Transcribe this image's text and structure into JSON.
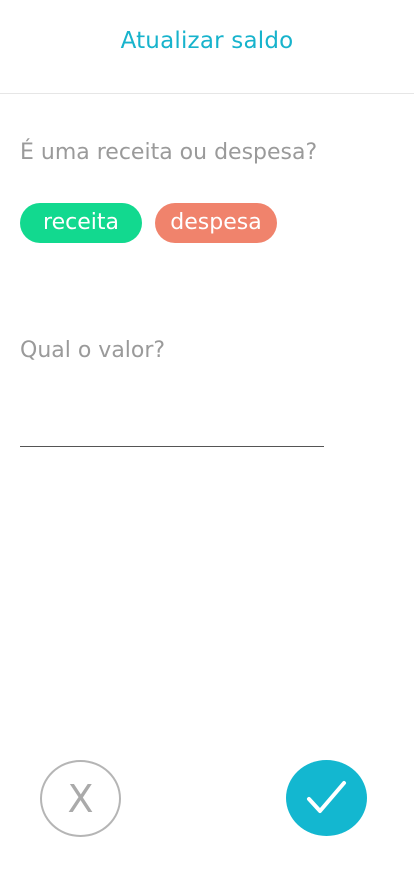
{
  "header": {
    "title": "Atualizar saldo"
  },
  "form": {
    "type_question": "É uma receita ou despesa?",
    "options": [
      {
        "label": "receita",
        "color": "#12d98f"
      },
      {
        "label": "despesa",
        "color": "#f0836c"
      }
    ],
    "value_question": "Qual o valor?",
    "value_input": {
      "value": "",
      "placeholder": ""
    }
  },
  "actions": {
    "cancel_label": "X",
    "cancel_icon": "close-icon",
    "confirm_icon": "check-icon"
  },
  "colors": {
    "accent": "#17b3cc",
    "confirm": "#13b7d0",
    "label_gray": "#9a9a9a"
  }
}
